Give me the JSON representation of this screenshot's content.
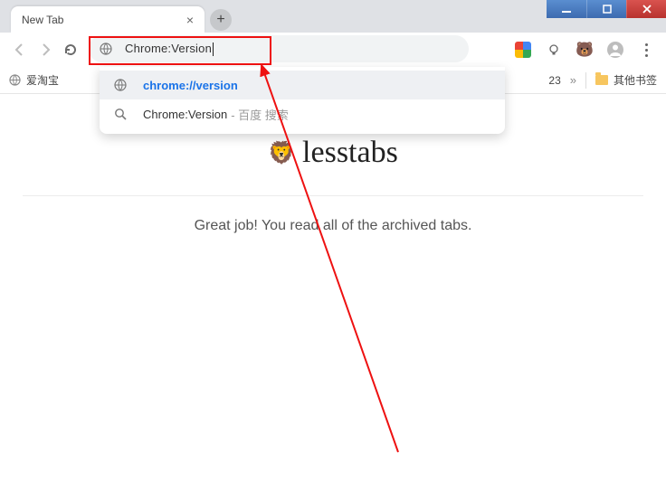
{
  "tab": {
    "title": "New Tab"
  },
  "address": {
    "value": "Chrome:Version"
  },
  "suggestions": {
    "row0": {
      "text": "chrome://version"
    },
    "row1": {
      "text": "Chrome:Version",
      "suffix": " - 百度 搜索"
    }
  },
  "bookmarks": {
    "item0": "爱淘宝",
    "truncated": "23",
    "overflow": "»",
    "other": "其他书签"
  },
  "page": {
    "brand": "lesstabs",
    "message": "Great job! You read all of the archived tabs."
  }
}
